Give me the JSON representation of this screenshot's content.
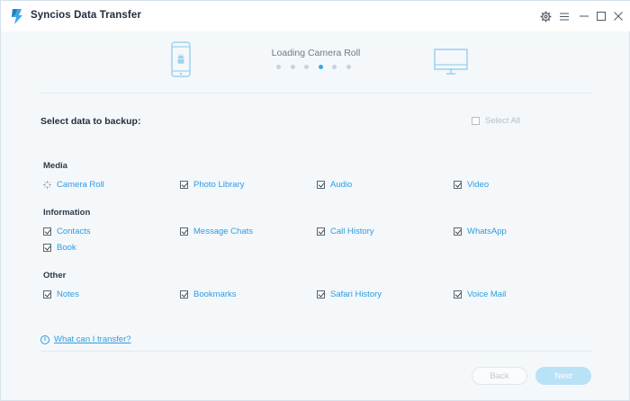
{
  "window": {
    "title": "Syncios Data Transfer"
  },
  "progress": {
    "status_label": "Loading Camera Roll",
    "step_count": 6,
    "active_step": 4
  },
  "backup": {
    "heading": "Select data to backup:",
    "select_all_label": "Select All",
    "select_all_checked": false
  },
  "groups": [
    {
      "title": "Media",
      "items": [
        {
          "label": "Camera Roll",
          "state": "loading"
        },
        {
          "label": "Photo Library",
          "state": "checked"
        },
        {
          "label": "Audio",
          "state": "checked"
        },
        {
          "label": "Video",
          "state": "checked"
        }
      ]
    },
    {
      "title": "Information",
      "items": [
        {
          "label": "Contacts",
          "state": "checked"
        },
        {
          "label": "Message Chats",
          "state": "checked"
        },
        {
          "label": "Call History",
          "state": "checked"
        },
        {
          "label": "WhatsApp",
          "state": "checked"
        },
        {
          "label": "Book",
          "state": "checked"
        }
      ]
    },
    {
      "title": "Other",
      "items": [
        {
          "label": "Notes",
          "state": "checked"
        },
        {
          "label": "Bookmarks",
          "state": "checked"
        },
        {
          "label": "Safari History",
          "state": "checked"
        },
        {
          "label": "Voice Mail",
          "state": "checked"
        }
      ]
    }
  ],
  "footer": {
    "help_label": "What can I transfer?",
    "back_label": "Back",
    "next_label": "Next"
  },
  "colors": {
    "accent": "#2f9be0",
    "dot_active": "#36a9e8",
    "next_button_bg": "#b9e2f7"
  },
  "icons": {
    "app": "syncios-logo-icon",
    "settings": "gear-icon",
    "menu": "menu-icon",
    "minimize": "minimize-icon",
    "maximize": "maximize-icon",
    "close": "close-icon",
    "source_device": "android-phone-icon",
    "target_device": "monitor-icon",
    "help": "info-icon",
    "loading": "spinner-icon"
  }
}
